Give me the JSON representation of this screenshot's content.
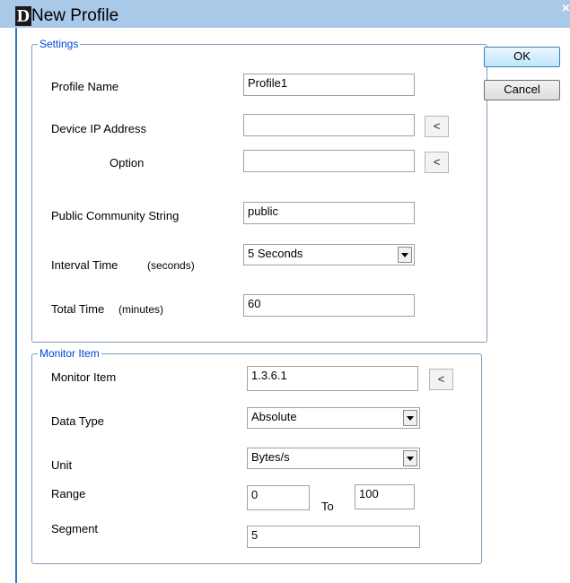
{
  "window": {
    "title": "New Profile",
    "logo_letter": "D",
    "close_glyph": "×"
  },
  "buttons": {
    "ok": "OK",
    "cancel": "Cancel",
    "pick_glyph": "<"
  },
  "settings": {
    "legend": "Settings",
    "profile_name_label": "Profile Name",
    "profile_name_value": "Profile1",
    "device_ip_label": "Device IP Address",
    "device_ip_value": "",
    "option_label": "Option",
    "option_value": "",
    "community_label": "Public Community String",
    "community_value": "public",
    "interval_label": "Interval Time",
    "interval_unit": "(seconds)",
    "interval_value": "5 Seconds",
    "total_label": "Total Time",
    "total_unit": "(minutes)",
    "total_value": "60"
  },
  "monitor": {
    "legend": "Monitor Item",
    "item_label": "Monitor Item",
    "item_value": "1.3.6.1",
    "data_type_label": "Data Type",
    "data_type_value": "Absolute",
    "unit_label": "Unit",
    "unit_value": "Bytes/s",
    "range_label": "Range",
    "range_from": "0",
    "range_to_label": "To",
    "range_to": "100",
    "segment_label": "Segment",
    "segment_value": "5"
  }
}
